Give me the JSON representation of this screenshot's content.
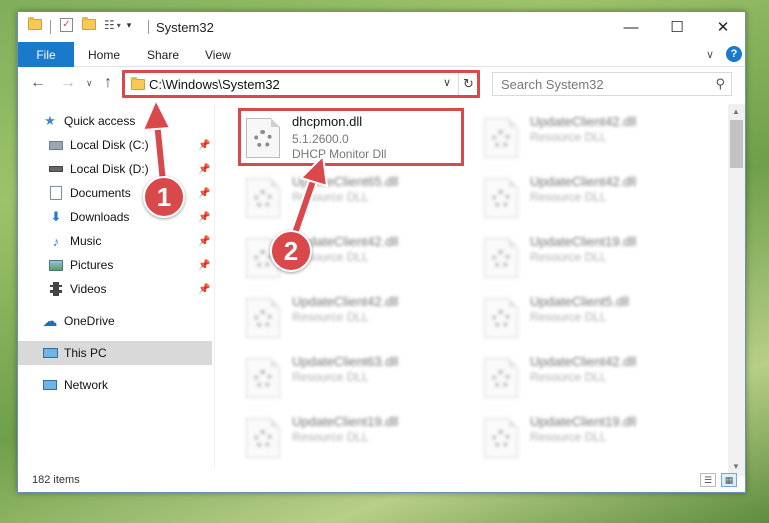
{
  "window": {
    "title": "System32",
    "controls": {
      "minimize": "—",
      "maximize": "☐",
      "close": "✕"
    }
  },
  "ribbon": {
    "tabs": [
      {
        "label": "File"
      },
      {
        "label": "Home"
      },
      {
        "label": "Share"
      },
      {
        "label": "View"
      }
    ],
    "help": "?"
  },
  "address": {
    "path": "C:\\Windows\\System32",
    "search_placeholder": "Search System32"
  },
  "nav": {
    "items": [
      {
        "label": "Quick access",
        "icon": "star-icon"
      },
      {
        "label": "Local Disk (C:)",
        "icon": "drive-icon",
        "pinned": true
      },
      {
        "label": "Local Disk (D:)",
        "icon": "drive-icon",
        "pinned": true
      },
      {
        "label": "Documents",
        "icon": "documents-icon",
        "pinned": true
      },
      {
        "label": "Downloads",
        "icon": "download-icon",
        "pinned": true
      },
      {
        "label": "Music",
        "icon": "music-icon",
        "pinned": true
      },
      {
        "label": "Pictures",
        "icon": "pictures-icon",
        "pinned": true
      },
      {
        "label": "Videos",
        "icon": "videos-icon",
        "pinned": true
      },
      {
        "label": "OneDrive",
        "icon": "cloud-icon"
      },
      {
        "label": "This PC",
        "icon": "computer-icon",
        "selected": true
      },
      {
        "label": "Network",
        "icon": "network-icon"
      }
    ]
  },
  "files": {
    "highlighted": {
      "name": "dhcpmon.dll",
      "version": "5.1.2600.0",
      "description": "DHCP Monitor Dll"
    },
    "col1": [
      {
        "name": "UpdateClient65.dll",
        "description": "Resource DLL"
      },
      {
        "name": "UpdateClient42.dll",
        "description": "Resource DLL"
      },
      {
        "name": "UpdateClient42.dll",
        "description": "Resource DLL"
      },
      {
        "name": "UpdateClient63.dll",
        "description": "Resource DLL"
      },
      {
        "name": "UpdateClient19.dll",
        "description": "Resource DLL"
      }
    ],
    "col2": [
      {
        "name": "UpdateClient42.dll",
        "description": "Resource DLL"
      },
      {
        "name": "UpdateClient42.dll",
        "description": "Resource DLL"
      },
      {
        "name": "UpdateClient19.dll",
        "description": "Resource DLL"
      },
      {
        "name": "UpdateClient5.dll",
        "description": "Resource DLL"
      },
      {
        "name": "UpdateClient42.dll",
        "description": "Resource DLL"
      },
      {
        "name": "UpdateClient19.dll",
        "description": "Resource DLL"
      }
    ]
  },
  "status": {
    "count": "182 items"
  },
  "annotations": {
    "badge1": "1",
    "badge2": "2",
    "color": "#d9484b"
  }
}
